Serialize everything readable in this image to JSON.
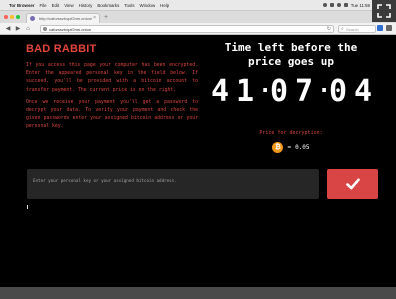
{
  "menubar": {
    "app_name": "Tor Browser",
    "items": [
      "File",
      "Edit",
      "View",
      "History",
      "Bookmarks",
      "Tools",
      "Window",
      "Help"
    ],
    "clock": "Tue 11:59"
  },
  "browser": {
    "tab_title": "http://caforssztxqzf2nm.onion/",
    "url": "caforssztxqzf2nm.onion",
    "search_placeholder": "Search"
  },
  "page": {
    "title": "BAD RABBIT",
    "paragraph1": "If you access this page your computer has been encrypted. Enter the appeared personal key in the field below. If succeed, you'll be provided with a bitcoin account to transfer payment. The current price is on the right.",
    "paragraph2": "Once we receive your payment you'll get a password to decrypt your data. To verify your payment and check the given passwords enter your assigned bitcoin address or your personal key.",
    "time_title": "Time left before the price goes up",
    "countdown": {
      "d1": "4",
      "d2": "1",
      "d3": "0",
      "d4": "7",
      "d5": "0",
      "d6": "4"
    },
    "price_label": "Price for decryption:",
    "price_value": "0.05",
    "btc_symbol": "₿",
    "input_placeholder": "Enter your personal key or your assigned bitcoin address.",
    "submit_icon": "checkmark-icon"
  },
  "colors": {
    "accent_red": "#e2453d",
    "submit_red": "#d94545",
    "bitcoin_orange": "#f0971a"
  }
}
